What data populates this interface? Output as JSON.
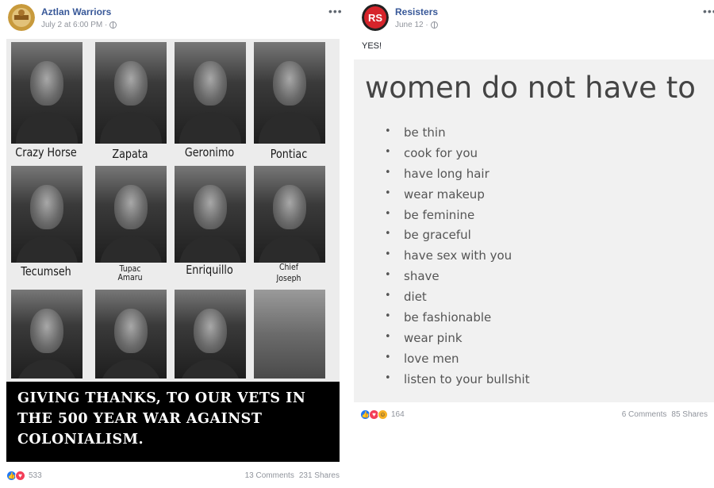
{
  "post_left": {
    "page_name": "Aztlan Warriors",
    "timestamp": "July 2 at 6:00 PM ·",
    "more_menu": "•••",
    "image": {
      "portraits": [
        {
          "caption": "Crazy Horse"
        },
        {
          "caption": "Zapata"
        },
        {
          "caption": "Geronimo"
        },
        {
          "caption": "Pontiac"
        },
        {
          "caption": "Tecumseh"
        },
        {
          "caption": "Tupac Amaru",
          "line1": "Tupac",
          "line2": "Amaru"
        },
        {
          "caption": "Enriquillo"
        },
        {
          "caption": "Chief Joseph",
          "line1": "Chief",
          "line2": "Joseph"
        },
        {
          "caption": ""
        },
        {
          "caption": ""
        },
        {
          "caption": ""
        },
        {
          "caption": ""
        }
      ],
      "banner_lines": [
        "GIVING THANKS, TO OUR VETS IN",
        "THE 500 YEAR WAR AGAINST",
        "COLONIALISM."
      ]
    },
    "reactions_count": "533",
    "comments": "13 Comments",
    "shares": "231 Shares"
  },
  "post_right": {
    "page_name": "Resisters",
    "avatar_text": "RS",
    "timestamp": "June 12 ·",
    "more_menu": "•••",
    "post_text": "YES!",
    "card": {
      "title": "women do not have to",
      "items": [
        "be thin",
        "cook for you",
        "have long hair",
        "wear makeup",
        "be feminine",
        "be graceful",
        "have sex with you",
        "shave",
        "diet",
        "be fashionable",
        "wear pink",
        "love men",
        "listen to your bullshit"
      ]
    },
    "reactions_count": "164",
    "comments": "6 Comments",
    "shares": "85 Shares"
  },
  "colors": {
    "link_blue": "#385898",
    "meta_gray": "#90949c",
    "like_blue": "#2078f4",
    "love_red": "#f33e58",
    "haha_yellow": "#f7b125",
    "resisters_red": "#d6242b",
    "aztlan_gold": "#c89a3c"
  },
  "icons": {
    "privacy": "globe-icon",
    "menu": "more-options-icon",
    "reactions_left": [
      "like-icon",
      "love-icon"
    ],
    "reactions_right": [
      "like-icon",
      "love-icon",
      "haha-icon"
    ]
  }
}
